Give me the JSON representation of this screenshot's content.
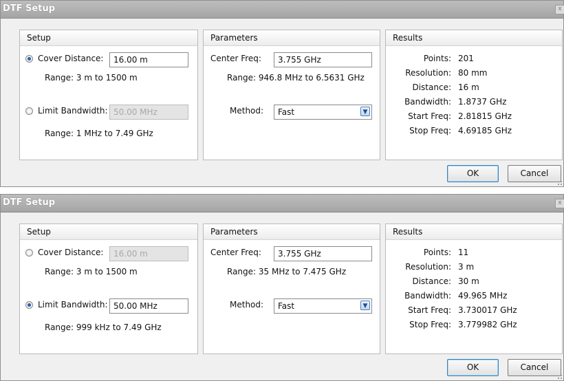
{
  "dialogs": [
    {
      "title": "DTF Setup",
      "close_glyph": "x",
      "setup": {
        "header": "Setup",
        "cover_label": "Cover Distance:",
        "cover_value": "16.00 m",
        "cover_selected": true,
        "cover_range": "Range: 3 m to 1500 m",
        "limit_label": "Limit Bandwidth:",
        "limit_value": "50.00 MHz",
        "limit_selected": false,
        "limit_range": "Range: 1 MHz to 7.49 GHz"
      },
      "parameters": {
        "header": "Parameters",
        "center_label": "Center Freq:",
        "center_value": "3.755 GHz",
        "center_range": "Range: 946.8 MHz to 6.5631 GHz",
        "method_label": "Method:",
        "method_value": "Fast"
      },
      "results": {
        "header": "Results",
        "rows": [
          {
            "label": "Points:",
            "value": "201"
          },
          {
            "label": "Resolution:",
            "value": "80 mm"
          },
          {
            "label": "Distance:",
            "value": "16 m"
          },
          {
            "label": "Bandwidth:",
            "value": "1.8737 GHz"
          },
          {
            "label": "Start Freq:",
            "value": "2.81815 GHz"
          },
          {
            "label": "Stop Freq:",
            "value": "4.69185 GHz"
          }
        ]
      },
      "buttons": {
        "ok": "OK",
        "cancel": "Cancel"
      }
    },
    {
      "title": "DTF Setup",
      "close_glyph": "x",
      "setup": {
        "header": "Setup",
        "cover_label": "Cover Distance:",
        "cover_value": "16.00 m",
        "cover_selected": false,
        "cover_range": "Range: 3 m to 1500 m",
        "limit_label": "Limit Bandwidth:",
        "limit_value": "50.00 MHz",
        "limit_selected": true,
        "limit_range": "Range: 999 kHz to 7.49 GHz"
      },
      "parameters": {
        "header": "Parameters",
        "center_label": "Center Freq:",
        "center_value": "3.755 GHz",
        "center_range": "Range: 35 MHz to 7.475 GHz",
        "method_label": "Method:",
        "method_value": "Fast"
      },
      "results": {
        "header": "Results",
        "rows": [
          {
            "label": "Points:",
            "value": "11"
          },
          {
            "label": "Resolution:",
            "value": "3 m"
          },
          {
            "label": "Distance:",
            "value": "30 m"
          },
          {
            "label": "Bandwidth:",
            "value": "49.965 MHz"
          },
          {
            "label": "Start Freq:",
            "value": "3.730017 GHz"
          },
          {
            "label": "Stop Freq:",
            "value": "3.779982 GHz"
          }
        ]
      },
      "buttons": {
        "ok": "OK",
        "cancel": "Cancel"
      }
    }
  ]
}
